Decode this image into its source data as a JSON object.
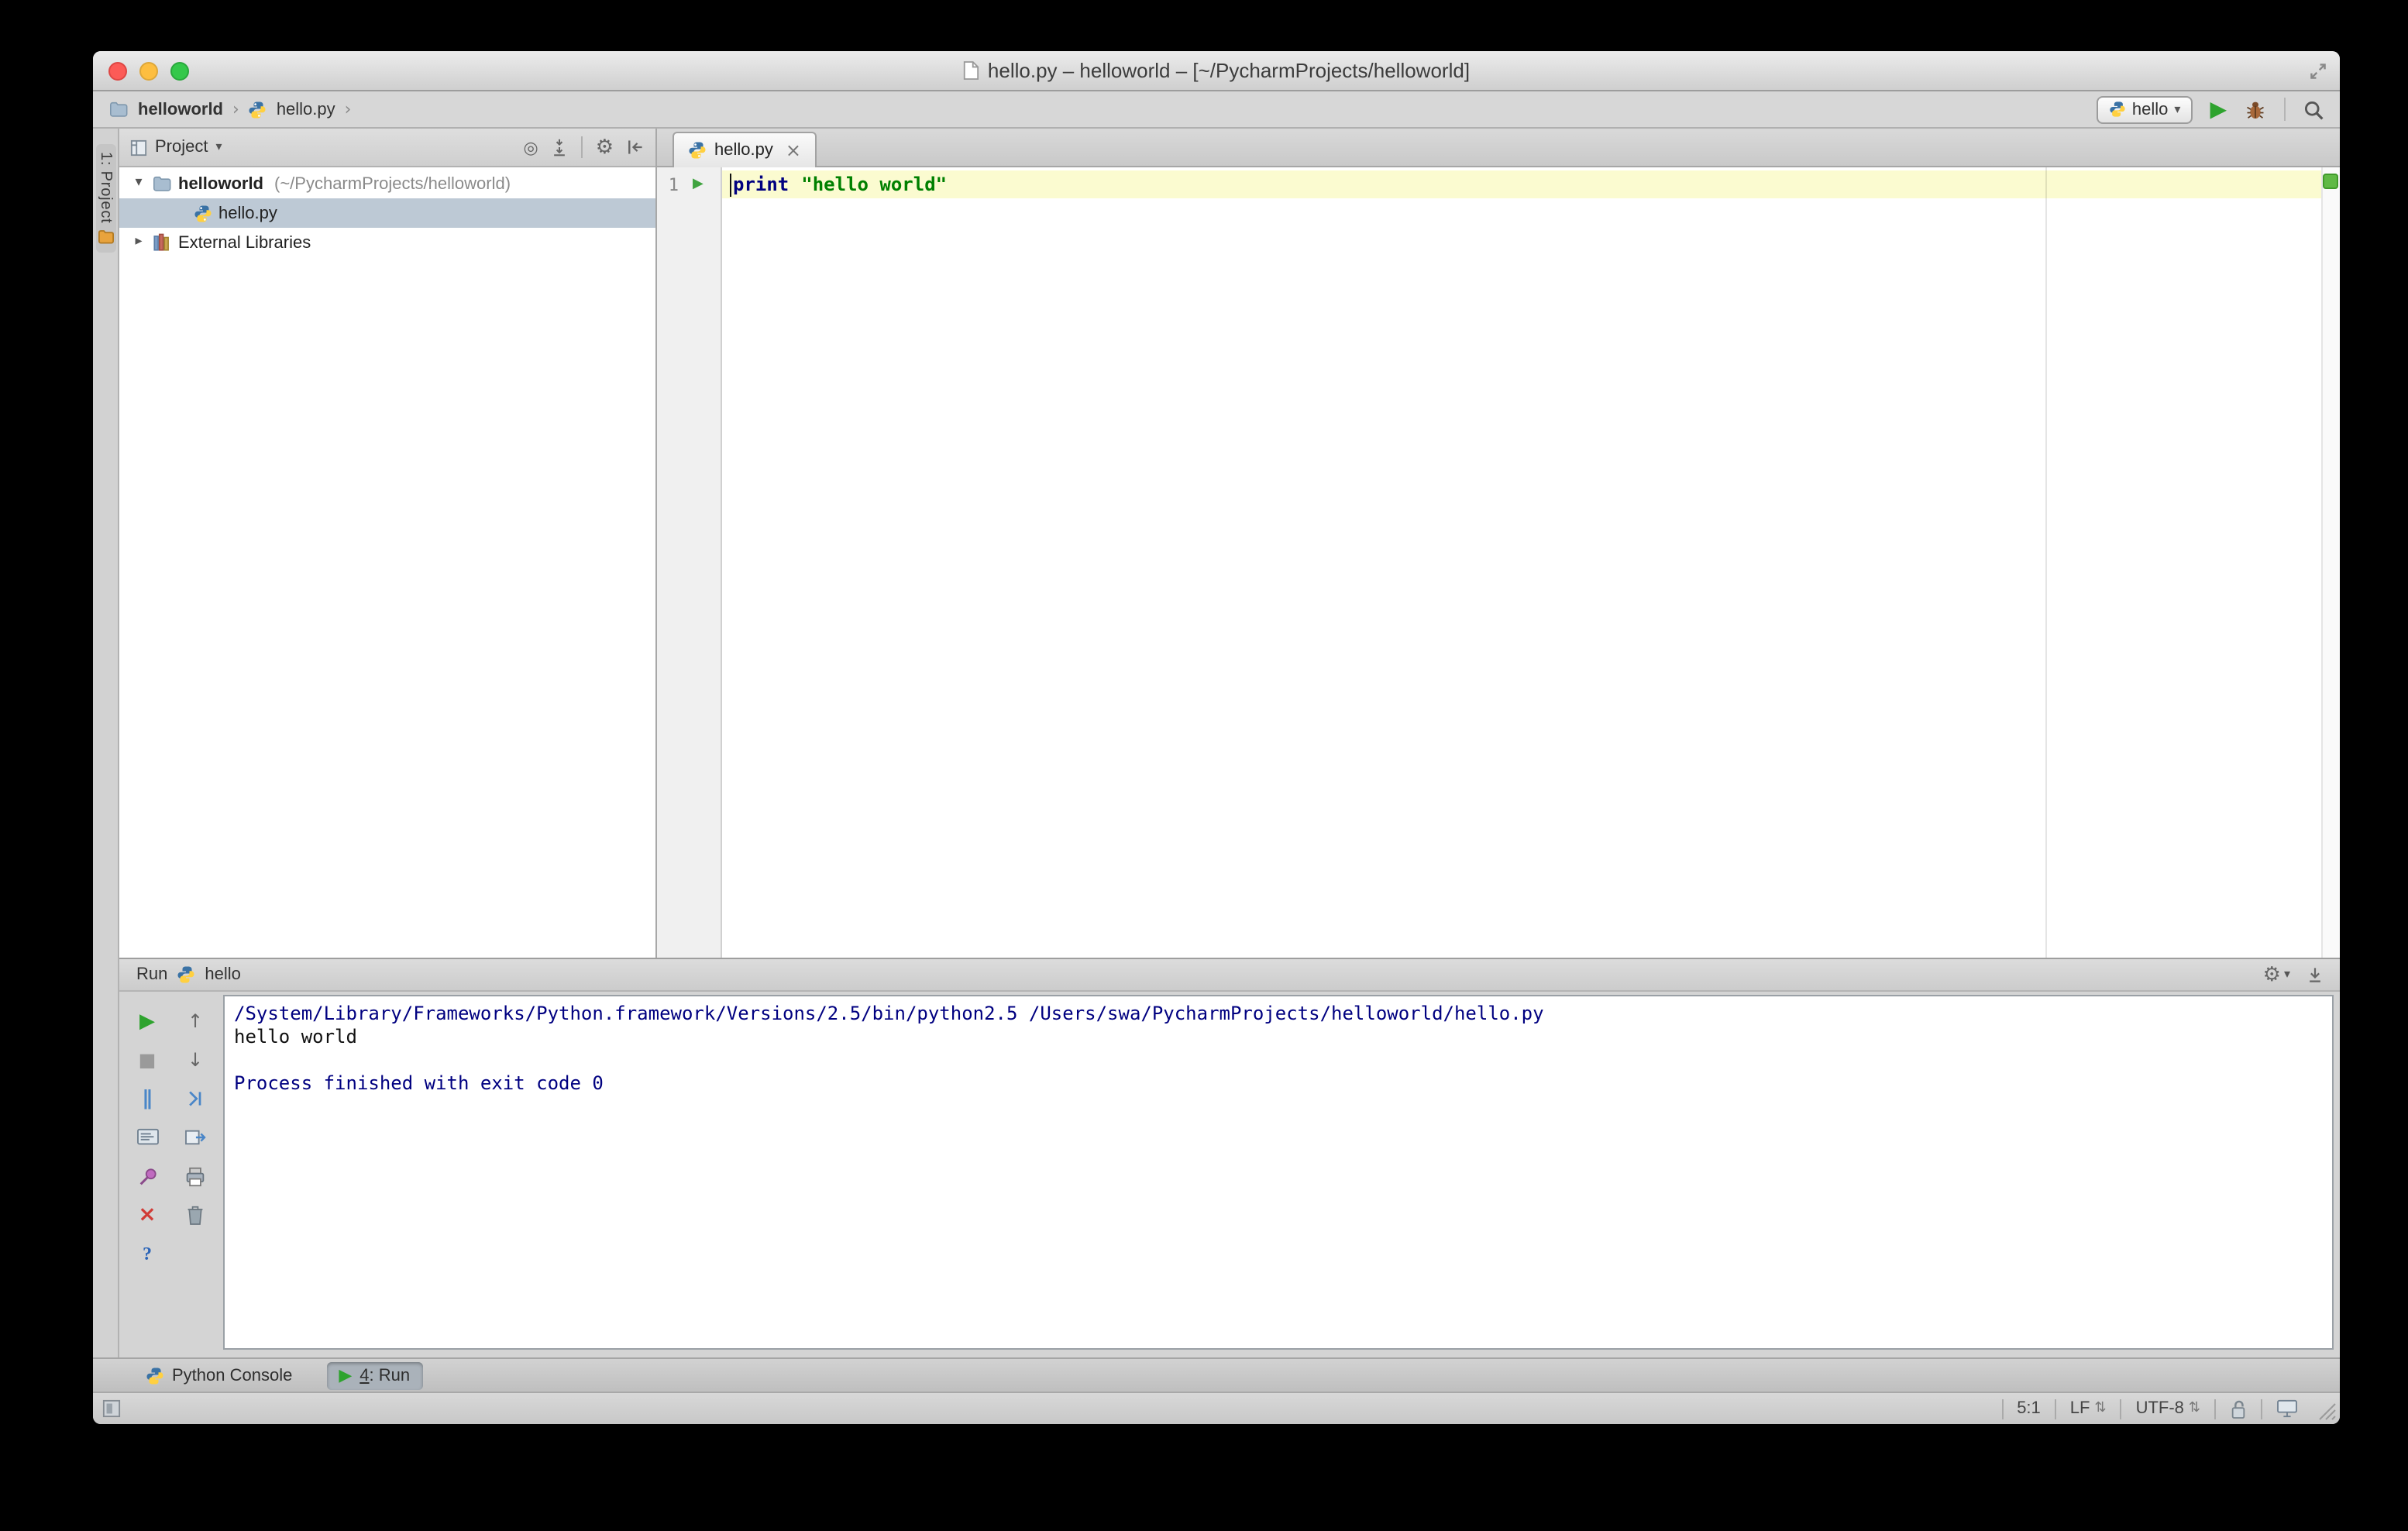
{
  "window": {
    "title": "hello.py – helloworld – [~/PycharmProjects/helloworld]"
  },
  "colors": {
    "run_green": "#2ea32e",
    "keyword_blue": "#000080",
    "string_green": "#008000",
    "console_system_blue": "#000080",
    "current_line_yellow": "#fbfbd0",
    "tree_selection": "#bdc9d5",
    "indicator_green": "#5fb945"
  },
  "icons": {
    "play": "▶",
    "stop": "■",
    "pause": "∥",
    "up": "↑",
    "down": "↓",
    "help": "?",
    "close": "×",
    "gear": "⚙",
    "target": "◎",
    "dropdown": "▾",
    "chevron": "›",
    "tree_expanded": "▾",
    "tree_collapsed": "▸",
    "updown": "⇅"
  },
  "nav": {
    "breadcrumbs": [
      {
        "label": "helloworld"
      },
      {
        "label": "hello.py"
      }
    ],
    "run_config": {
      "label": "hello"
    }
  },
  "project": {
    "stripe_label": "1: Project",
    "header_label": "Project",
    "tree": {
      "root_name": "helloworld",
      "root_path": "(~/PycharmProjects/helloworld)",
      "file_name": "hello.py",
      "external_libraries": "External Libraries"
    }
  },
  "editor": {
    "tab_label": "hello.py",
    "line_number": "1",
    "code": {
      "keyword": "print",
      "string": "\"hello world\""
    }
  },
  "run": {
    "panel_title": "Run",
    "config_name": "hello",
    "console_lines": [
      "/System/Library/Frameworks/Python.framework/Versions/2.5/bin/python2.5 /Users/swa/PycharmProjects/helloworld/hello.py",
      "hello world",
      "",
      "Process finished with exit code 0"
    ]
  },
  "bottom_tabs": {
    "python_console": "Python Console",
    "run_number": "4",
    "run_label": ": Run"
  },
  "status_bar": {
    "caret_position": "5:1",
    "line_separator": "LF",
    "encoding": "UTF-8"
  }
}
